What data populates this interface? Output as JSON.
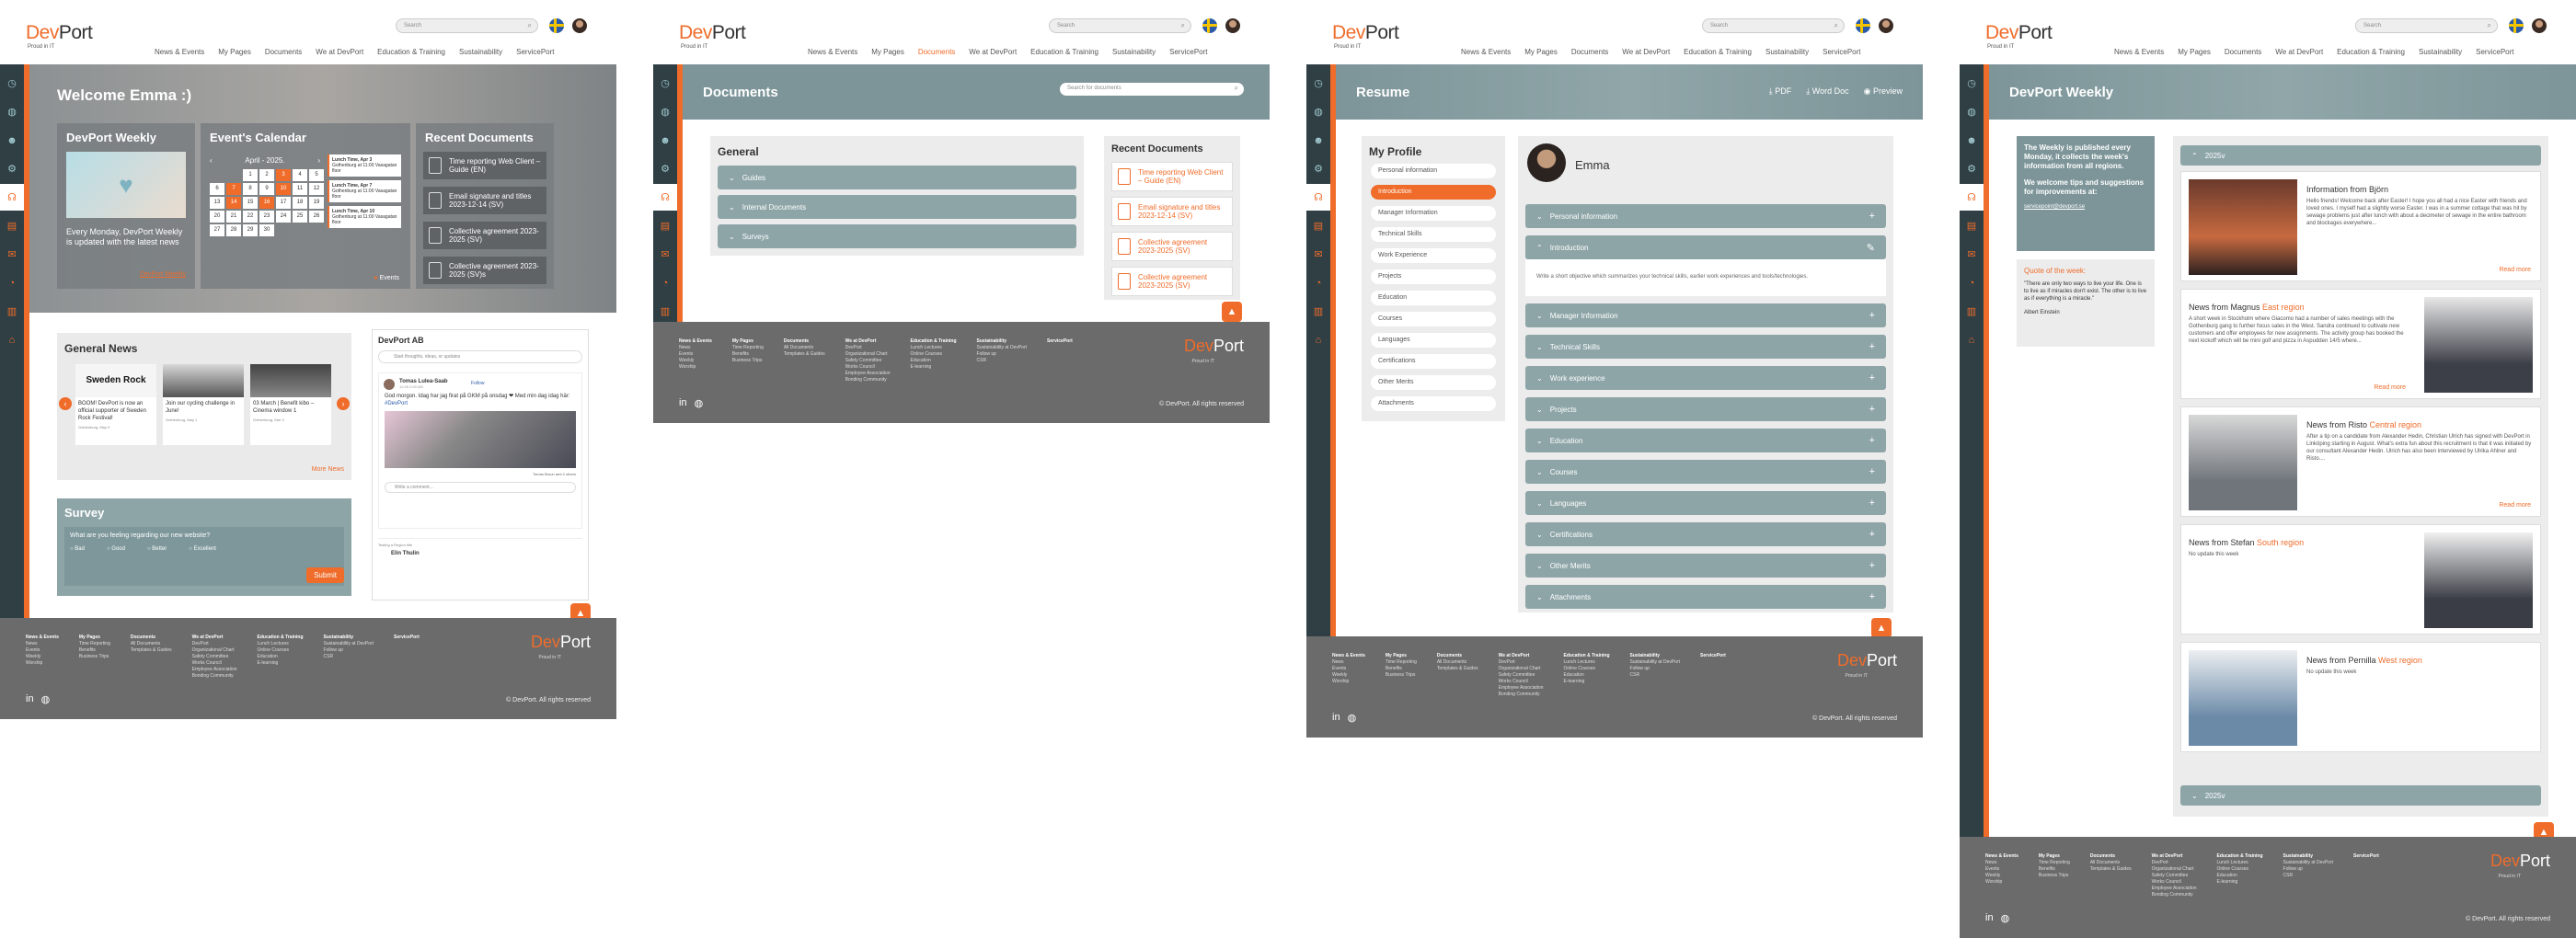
{
  "brand": {
    "logo_a": "Dev",
    "logo_b": "Port",
    "tagline": "Proud in IT"
  },
  "search_placeholder": "Search",
  "nav": [
    "News & Events",
    "My Pages",
    "Documents",
    "We at DevPort",
    "Education & Training",
    "Sustainability",
    "ServicePort"
  ],
  "colors": {
    "accent": "#ef6c2a",
    "sidebar": "#2f3f44",
    "teal": "#8ea5a8",
    "footer": "#6b6b6b"
  },
  "sidebar_icons": [
    "clock-icon",
    "globe-icon",
    "users-icon",
    "settings-icon",
    "headset-icon",
    "document-icon",
    "chat-icon",
    "chart-icon",
    "book-icon",
    "graduation-icon"
  ],
  "footer": {
    "cols": [
      {
        "title": "News & Events",
        "items": [
          "News",
          "Events",
          "Weekly",
          "Worship"
        ]
      },
      {
        "title": "My Pages",
        "items": [
          "Time Reporting",
          "Benefits",
          "Business Trips"
        ]
      },
      {
        "title": "Documents",
        "items": [
          "All Documents",
          "Templates & Guides"
        ]
      },
      {
        "title": "We at DevPort",
        "items": [
          "DevPort",
          "Organizational Chart",
          "Safety Committee",
          "Works Council",
          "Employee Association",
          "Bonding Community"
        ]
      },
      {
        "title": "Education & Training",
        "items": [
          "Lunch Lectures",
          "Online Courses",
          "Education",
          "E-learning"
        ]
      },
      {
        "title": "Sustainability",
        "items": [
          "Sustainability at DevPort",
          "Follow up",
          "CSR"
        ]
      },
      {
        "title": "ServicePort",
        "items": []
      }
    ],
    "copyright": "© DevPort. All rights reserved",
    "logo_a": "Dev",
    "logo_b": "Port",
    "tagline": "Proud in IT"
  },
  "home": {
    "welcome": "Welcome Emma :)",
    "weekly": {
      "title": "DevPort Weekly",
      "text": "Every Monday, DevPort Weekly is updated with the latest news",
      "link": "DevPort Weekly"
    },
    "calendar": {
      "title": "Event's Calendar",
      "month": "April",
      "year": "2025.",
      "events": [
        {
          "title": "Lunch Time, Apr 3",
          "place": "Gothenburg at 11:00 Vasagatan floor"
        },
        {
          "title": "Lunch Time, Apr 7",
          "place": "Gothenburg at 11:00 Vasagatan floor"
        },
        {
          "title": "Lunch Time, Apr 10",
          "place": "Gothenburg at 11:00 Vasagatan floor"
        }
      ],
      "legend": "Events"
    },
    "recent_title": "Recent Documents",
    "recent": [
      "Time reporting Web Client – Guide (EN)",
      "Email signature and titles 2023-12-14 (SV)",
      "Collective agreement 2023-2025 (SV)",
      "Collective agreement 2023-2025 (SV)s"
    ],
    "general_news": {
      "title": "General News",
      "items": [
        {
          "img": "Sweden Rock",
          "text": "BOOM! DevPort is now an official supporter of Sweden Rock Festival!",
          "date": "Gothenburg, May 9"
        },
        {
          "text": "Join our cycling challenge in June!",
          "date": "Gothenburg, May 1"
        },
        {
          "text": "03 March | Benefit kibo – Cinema window 1",
          "date": "Gothenburg, Mar 3"
        }
      ],
      "more": "More News"
    },
    "devport_ab": "DevPort AB",
    "share": "Start thoughts, ideas, or updates",
    "post": {
      "author": "Tomas Lulea-Saab",
      "time": "12:45 2:00 AM",
      "follow": "Follow",
      "text": "God morgon. Idag har jag firat på GKM på onsdag ❤ Med min dag idag här:",
      "link": "#DevPort",
      "comment": "Write a comment...",
      "reactions": "Tomas Bruun and 4 others"
    },
    "post2": {
      "author": "Elin Thulin",
      "label": "Testing a Region title"
    },
    "survey": {
      "title": "Survey",
      "question": "What are you feeling regarding our new website?",
      "options": [
        "Bad",
        "Good",
        "Better",
        "Excellent"
      ],
      "submit": "Submit"
    }
  },
  "documents": {
    "title": "Documents",
    "search": "Search for documents",
    "general": "General",
    "sections": [
      "Guides",
      "Internal Documents",
      "Surveys"
    ],
    "recent_title": "Recent Documents",
    "recent": [
      "Time reporting Web Client – Guide (EN)",
      "Email signature and titles 2023-12-14 (SV)",
      "Collective agreement 2023-2025 (SV)",
      "Collective agreement 2023-2025 (SV)"
    ]
  },
  "resume": {
    "title": "Resume",
    "actions": [
      "PDF",
      "Word Doc",
      "Preview"
    ],
    "profile_title": "My Profile",
    "menu": [
      "Personal information",
      "Introduction",
      "Manager Information",
      "Technical Skills",
      "Work Experience",
      "Projects",
      "Education",
      "Courses",
      "Languages",
      "Certifications",
      "Other Merits",
      "Attachments"
    ],
    "active": "Introduction",
    "name": "Emma",
    "intro_text": "Write a short objective which summarizes your technical skills, earlier work experiences and tools/technologies.",
    "sections": [
      "Personal information",
      "Introduction",
      "Manager Information",
      "Technical Skills",
      "Work experience",
      "Projects",
      "Education",
      "Courses",
      "Languages",
      "Certifications",
      "Other Merits",
      "Attachments"
    ]
  },
  "weekly": {
    "title": "DevPort Weekly",
    "info": "The Weekly is published every Monday, it collects the week's information from all regions.",
    "tips": "We welcome tips and suggestions for improvements at:",
    "email": "servicepoint@devport.se",
    "quote_title": "Quote of the week:",
    "quote": "\"There are only two ways to live your life. One is to live as if miracles don't exist. The other is to live as if everything is a miracle.\"",
    "quote_author": "Albert Einstein",
    "year1": "2025v",
    "year2": "2025v",
    "items": [
      {
        "head": "Information from Björn",
        "region": "",
        "text": "Hello friends! Welcome back after Easter! I hope you all had a nice Easter with friends and loved ones. I myself had a slightly worse Easter. I was in a summer cottage that was hit by sewage problems just after lunch with about a decimeter of sewage in the entire bathroom and blockages everywhere...",
        "more": "Read more"
      },
      {
        "head": "News from Magnus",
        "region": "East region",
        "text": "A short week in Stockholm where Giacomo had a number of sales meetings with the Gothenburg gang to further focus sales in the West. Sandra continued to cultivate new customers and offer employees for new assignments. The activity group has booked the next kickoff which will be mini golf and pizza in Aspudden 14/5 where...",
        "more": "Read more"
      },
      {
        "head": "News from Risto",
        "region": "Central region",
        "text": "After a tip on a candidate from Alexander Hedin, Christian Ulrich has signed with DevPort in Linköping starting in August. What's extra fun about this recruitment is that it was initiated by our consultant Alexander Hedin. Ulrich has also been interviewed by Ulrika Ahlner and Risto....",
        "more": "Read more"
      },
      {
        "head": "News from Stefan",
        "region": "South region",
        "text": "No update this week",
        "more": ""
      },
      {
        "head": "News from Pernilla",
        "region": "West region",
        "text": "No update this week",
        "more": ""
      }
    ]
  }
}
